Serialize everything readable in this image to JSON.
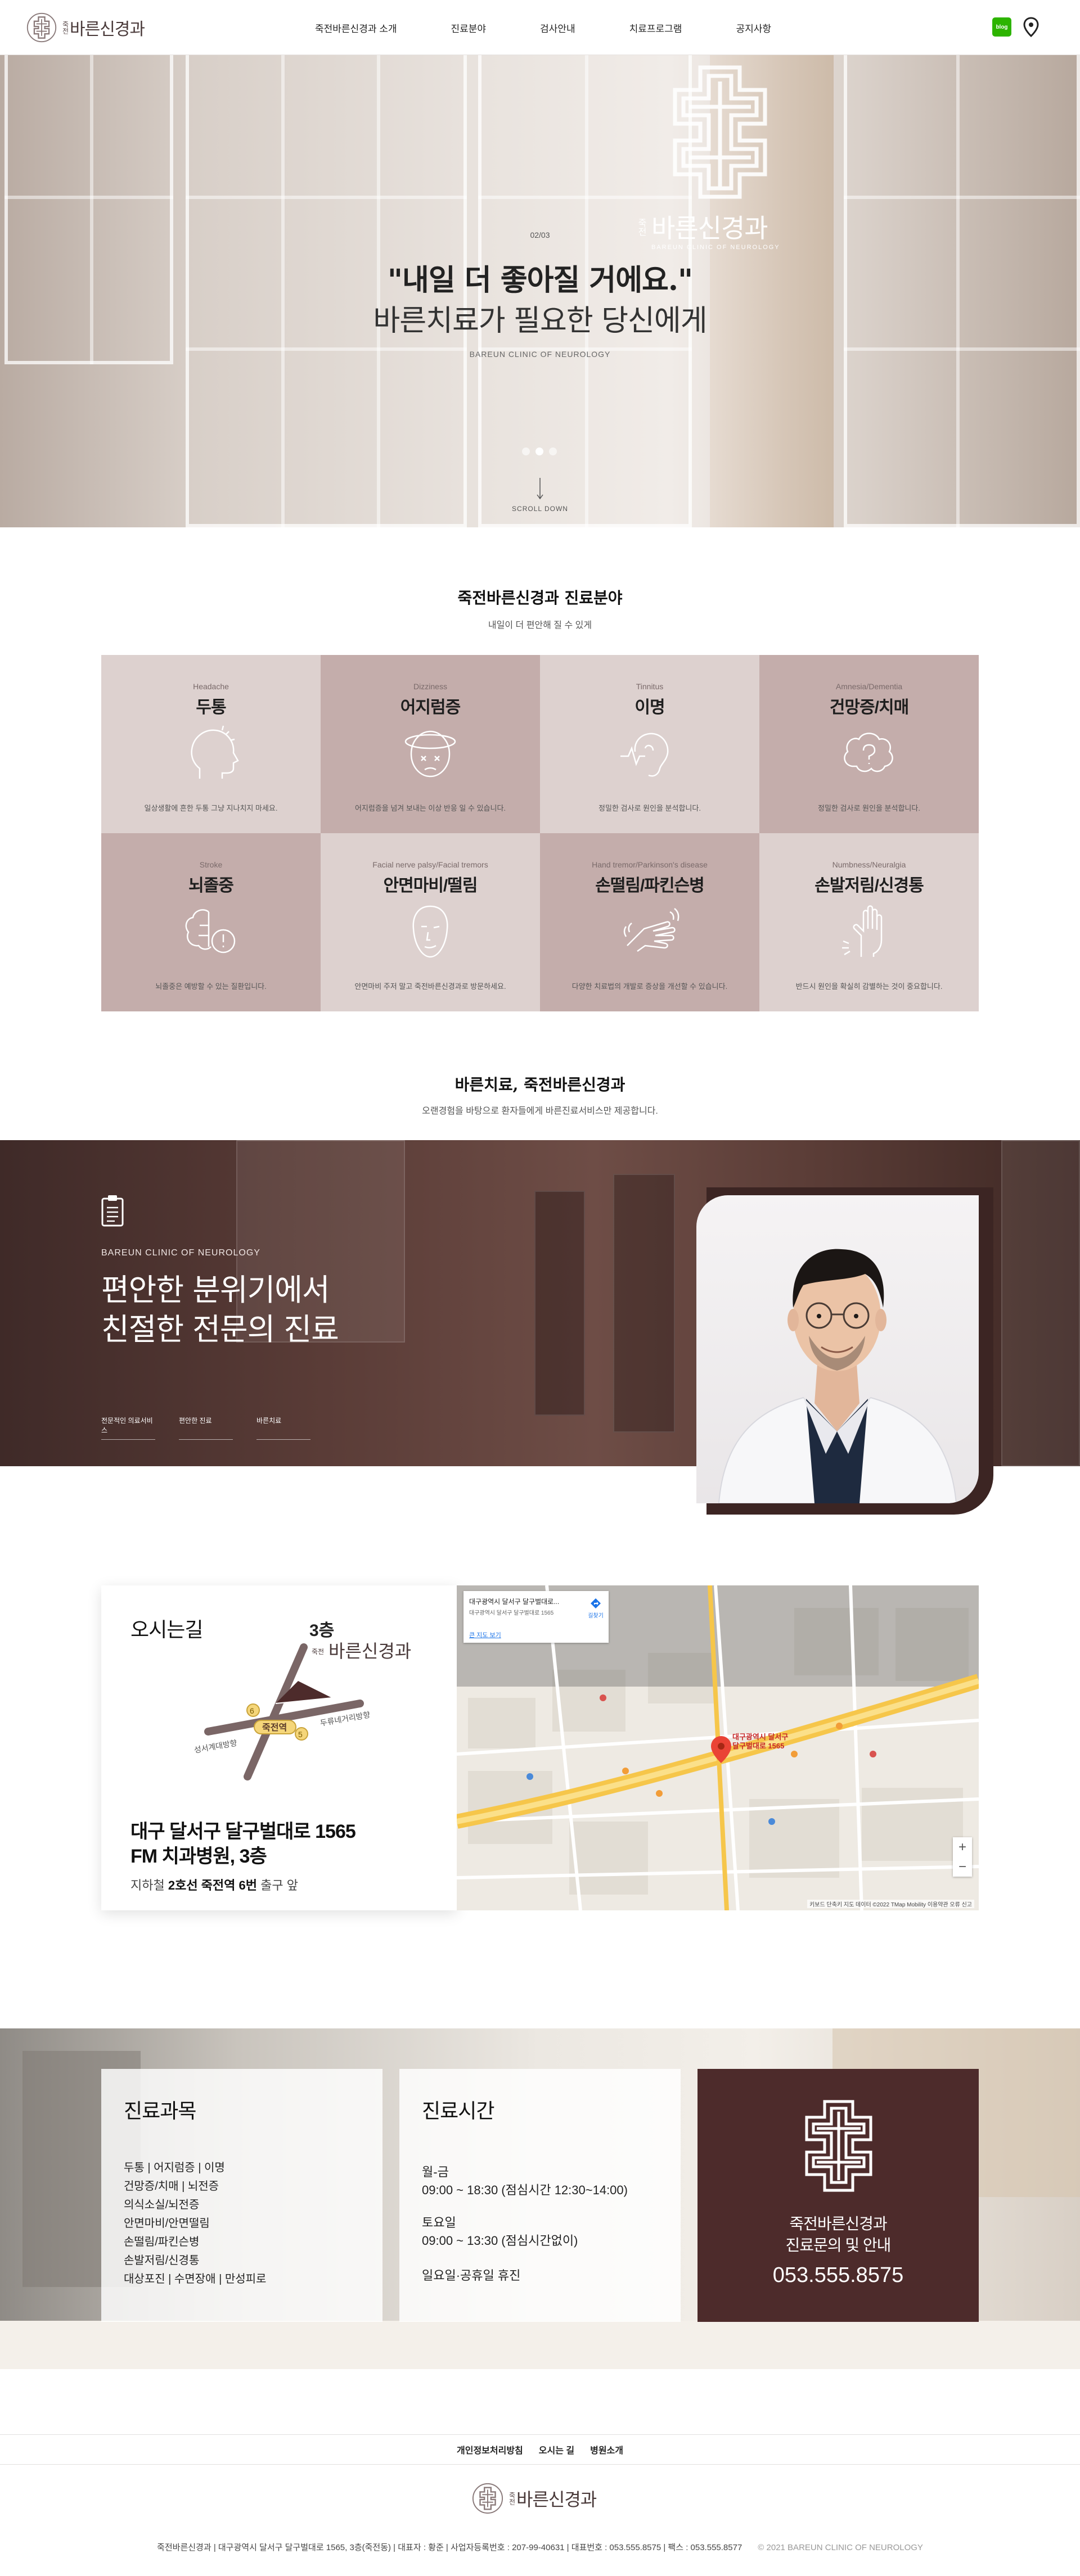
{
  "header": {
    "logo_small": "죽전",
    "logo_big": "바른신경과",
    "nav": [
      "죽전바른신경과 소개",
      "진료분야",
      "검사안내",
      "치료프로그램",
      "공지사항"
    ],
    "blog_label": "blog"
  },
  "hero": {
    "brand_small": "죽전",
    "brand_big": "바른신경과",
    "brand_en": "BAREUN CLINIC OF NEUROLOGY",
    "counter": "02/03",
    "line1": "\"내일 더 좋아질 거에요.\"",
    "line2": "바른치료가 필요한 당신에게",
    "subtitle": "BAREUN CLINIC OF NEUROLOGY",
    "scroll": "SCROLL DOWN",
    "slides": 3,
    "current_slide": 2
  },
  "specialties": {
    "title": "죽전바른신경과 진료분야",
    "subtitle": "내일이 더 편안해 질 수 있게",
    "items": [
      {
        "en": "Headache",
        "ko": "두통",
        "desc": "일상생활에 흔한 두통 그냥 지나치지 마세요.",
        "icon": "head-icon"
      },
      {
        "en": "Dizziness",
        "ko": "어지럼증",
        "desc": "어지럼증을 넘겨 보내는 이상 반응 일 수 있습니다.",
        "icon": "dizzy-head-icon"
      },
      {
        "en": "Tinnitus",
        "ko": "이명",
        "desc": "정밀한 검사로 원인을 분석합니다.",
        "icon": "ear-icon"
      },
      {
        "en": "Amnesia/Dementia",
        "ko": "건망증/치매",
        "desc": "정밀한 검사로 원인을 분석합니다.",
        "icon": "brain-question-icon"
      },
      {
        "en": "Stroke",
        "ko": "뇌졸중",
        "desc": "뇌졸중은 예방할 수 있는 질환입니다.",
        "icon": "brain-alert-icon"
      },
      {
        "en": "Facial nerve palsy/Facial tremors",
        "ko": "안면마비/떨림",
        "desc": "안면마비 주저 말고 죽전바른신경과로 방문하세요.",
        "icon": "face-icon"
      },
      {
        "en": "Hand tremor/Parkinson's disease",
        "ko": "손떨림/파킨슨병",
        "desc": "다양한 치료법의 개발로 증상을 개선할 수 있습니다.",
        "icon": "hand-tremor-icon"
      },
      {
        "en": "Numbness/Neuralgia",
        "ko": "손발저림/신경통",
        "desc": "반드시 원인을 확실히 감별하는 것이 중요합니다.",
        "icon": "hand-numb-icon"
      }
    ]
  },
  "about": {
    "title": "바른치료, 죽전바른신경과",
    "subtitle": "오랜경험을 바탕으로 환자들에게 바른진료서비스만 제공합니다.",
    "en": "BAREUN CLINIC OF NEUROLOGY",
    "line1": "편안한 분위기에서",
    "line2": "친절한 전문의 진료",
    "links": [
      "전문적인 의료서비스",
      "편안한 진료",
      "바른치료"
    ]
  },
  "location": {
    "title": "오시는길",
    "floor_label": "3층",
    "sketch_brand_small": "죽전",
    "sketch_brand_big": "바른신경과",
    "station": "죽전역",
    "exit_top": "6",
    "exit_bottom": "5",
    "left_road": "성서계대방향",
    "right_road": "두류네거리방향",
    "addr1": "대구 달서구 달구벌대로 1565",
    "addr2": "FM 치과병원, 3층",
    "sub_prefix": "지하철 ",
    "sub_bold": "2호선 죽전역 6번",
    "sub_suffix": " 출구 앞",
    "map": {
      "info_line1": "대구광역시 달서구 달구벌대로...",
      "info_line2": "대구광역시 달서구 달구벌대로 1565",
      "info_link": "큰 지도 보기",
      "directions": "길찾기",
      "marker_label1": "대구광역시 달서구",
      "marker_label2": "달구벌대로 1565",
      "credit": "키보드 단축키  지도 데이터 ©2022 TMap Mobility  이용약관  오류 신고"
    }
  },
  "info": {
    "departments_title": "진료과목",
    "departments": [
      "두통 | 어지럼증 | 이명",
      "건망증/치매 | 뇌전증",
      "의식소실/뇌전증",
      "안면마비/안면떨림",
      "손떨림/파킨슨병",
      "손발저림/신경통",
      "대상포진 | 수면장애 | 만성피로"
    ],
    "hours_title": "진료시간",
    "weekday_label": "월-금",
    "weekday_hours": "09:00 ~ 18:30 (점심시간 12:30~14:00)",
    "sat_label": "토요일",
    "sat_hours": "09:00 ~ 13:30 (점심시간없이)",
    "closed": "일요일·공휴일 휴진",
    "contact_line1": "죽전바른신경과",
    "contact_line2": "진료문의 및 안내",
    "phone": "053.555.8575"
  },
  "footer": {
    "links": [
      "개인정보처리방침",
      "오시는 길",
      "병원소개"
    ],
    "logo_small": "죽전",
    "logo_big": "바른신경과",
    "info": "죽전바른신경과 | 대구광역시 달서구 달구벌대로 1565, 3층(죽전동) | 대표자 : 황준 | 사업자등록번호 : 207-99-40631 | 대표번호 : 053.555.8575 | 팩스 : 053.555.8577",
    "copyright": "© 2021 BAREUN CLINIC OF NEUROLOGY"
  },
  "colors": {
    "accent": "#4d2b2b",
    "cell_light": "#ddd1cf",
    "cell_dark": "#c4adab"
  }
}
